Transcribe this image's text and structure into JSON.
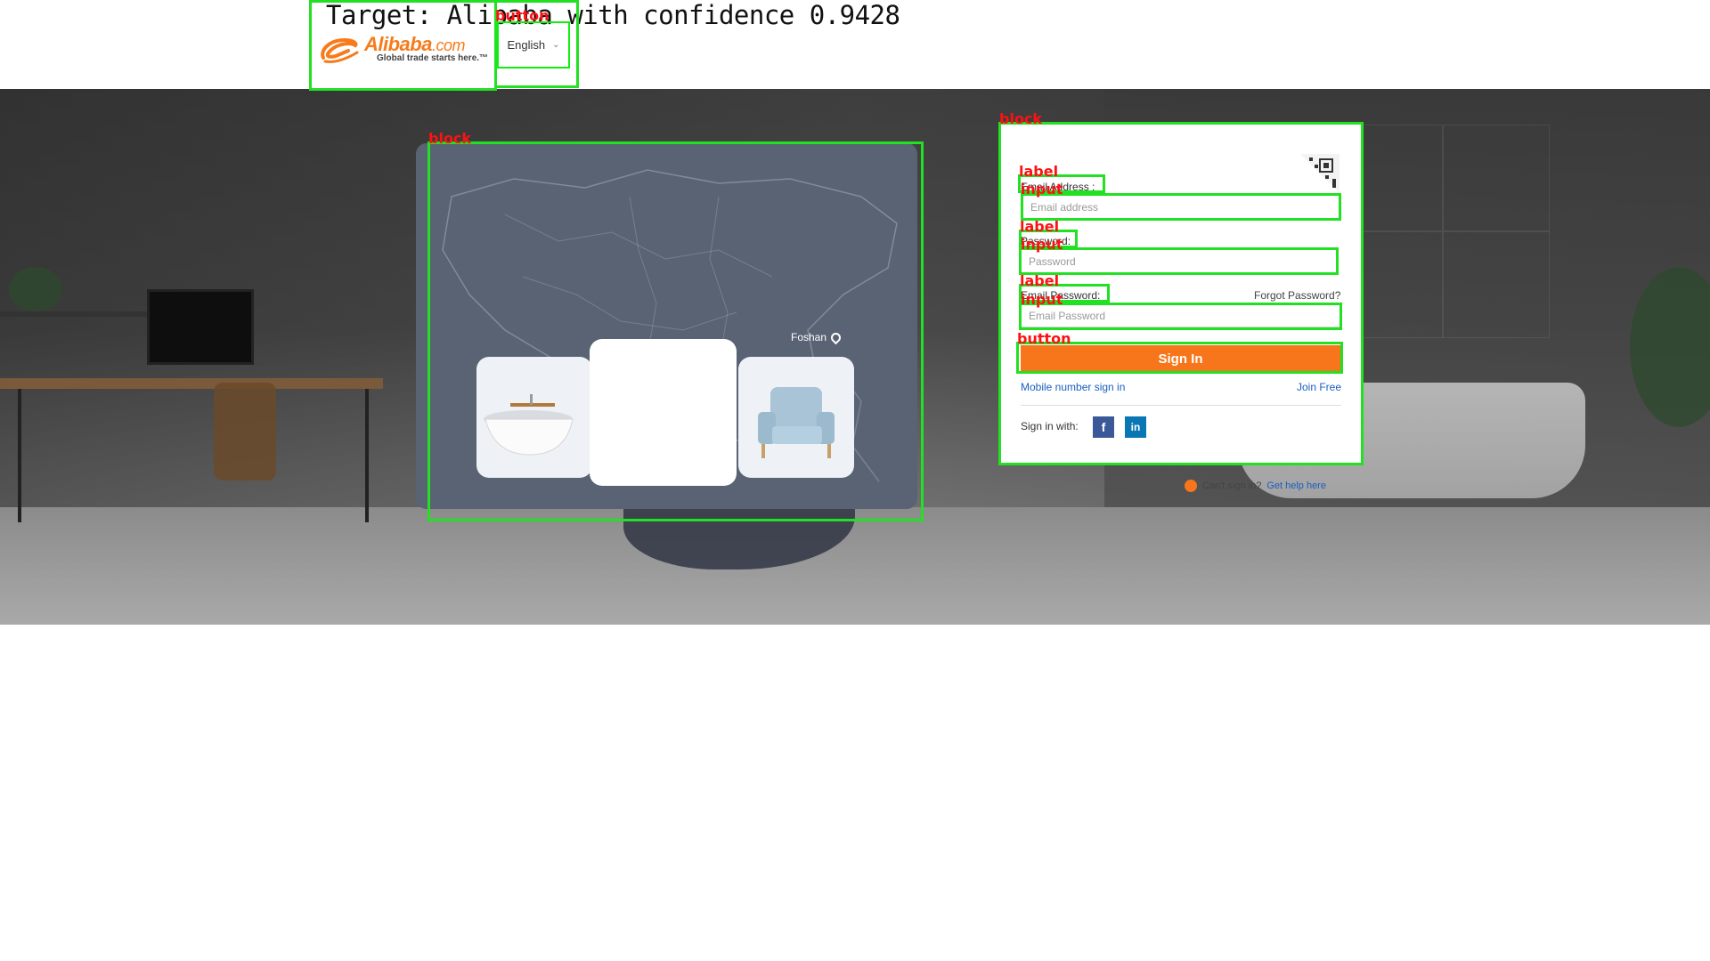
{
  "overlay": {
    "target_text": "Target: Alibaba with confidence 0.9428",
    "labels": {
      "button_lang": "button",
      "block_map": "block",
      "block_form": "block",
      "label_email": "label",
      "input_email": "input",
      "label_password": "label",
      "input_password": "input",
      "label_email_password": "label",
      "input_email_password": "input",
      "button_signin": "button"
    },
    "box_color": "#22e022",
    "label_color": "#ff1111"
  },
  "header": {
    "logo_wordmark": "Alibaba",
    "logo_com": ".com",
    "logo_tagline": "Global trade starts here.™",
    "language": "English",
    "brand_color": "#f77b1b"
  },
  "hero": {
    "map_label": "Foshan"
  },
  "form": {
    "email_label": "Email Address :",
    "email_placeholder": "Email address",
    "password_label": "Password:",
    "password_placeholder": "Password",
    "email_password_label": "Email Password:",
    "forgot_password": "Forgot Password?",
    "email_password_placeholder": "Email Password",
    "signin_button": "Sign In",
    "mobile_signin": "Mobile number sign in",
    "join_free": "Join Free",
    "sign_in_with": "Sign in with:",
    "social": [
      "f",
      "in"
    ],
    "cant_sign_in": "Can't sign in?",
    "get_help": "Get help here",
    "button_color": "#f7761b"
  }
}
